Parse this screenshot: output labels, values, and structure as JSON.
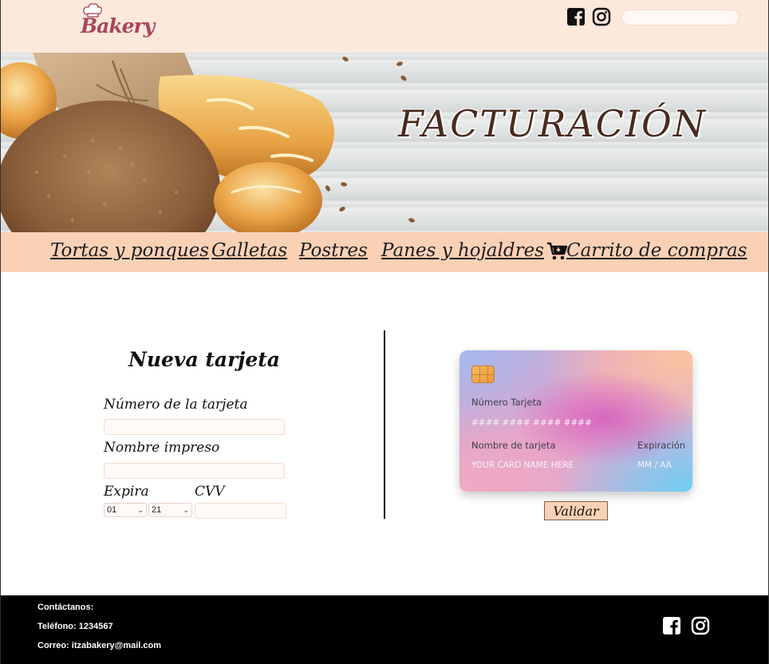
{
  "header": {
    "logo_text": "Bakery",
    "search_placeholder": "",
    "icons": [
      "facebook-icon",
      "instagram-icon"
    ]
  },
  "banner": {
    "title": "FACTURACIÓN"
  },
  "nav": {
    "items": [
      "Tortas y ponques",
      "Galletas",
      "Postres",
      "Panes y hojaldres",
      "Carrito de compras"
    ]
  },
  "form": {
    "title": "Nueva tarjeta",
    "card_number_label": "Número de la tarjeta",
    "name_label": "Nombre impreso",
    "expires_label": "Expira",
    "cvv_label": "CVV",
    "month_value": "01",
    "year_value": "21"
  },
  "card": {
    "number_label": "Número Tarjeta",
    "number_value": "#### #### #### ####",
    "name_label": "Nombre de tarjeta",
    "name_value": "YOUR CARD NAME HERE",
    "expiry_label": "Expiración",
    "expiry_value": "MM / AA"
  },
  "validate_label": "Validar",
  "footer": {
    "contact": "Contáctanos:",
    "phone": "Teléfono: 1234567",
    "email": "Correo: itzabakery@mail.com"
  },
  "colors": {
    "header_bg": "#fde8dc",
    "nav_bg": "#fbd1b6",
    "footer_bg": "#000000",
    "logo": "#a8475a"
  }
}
